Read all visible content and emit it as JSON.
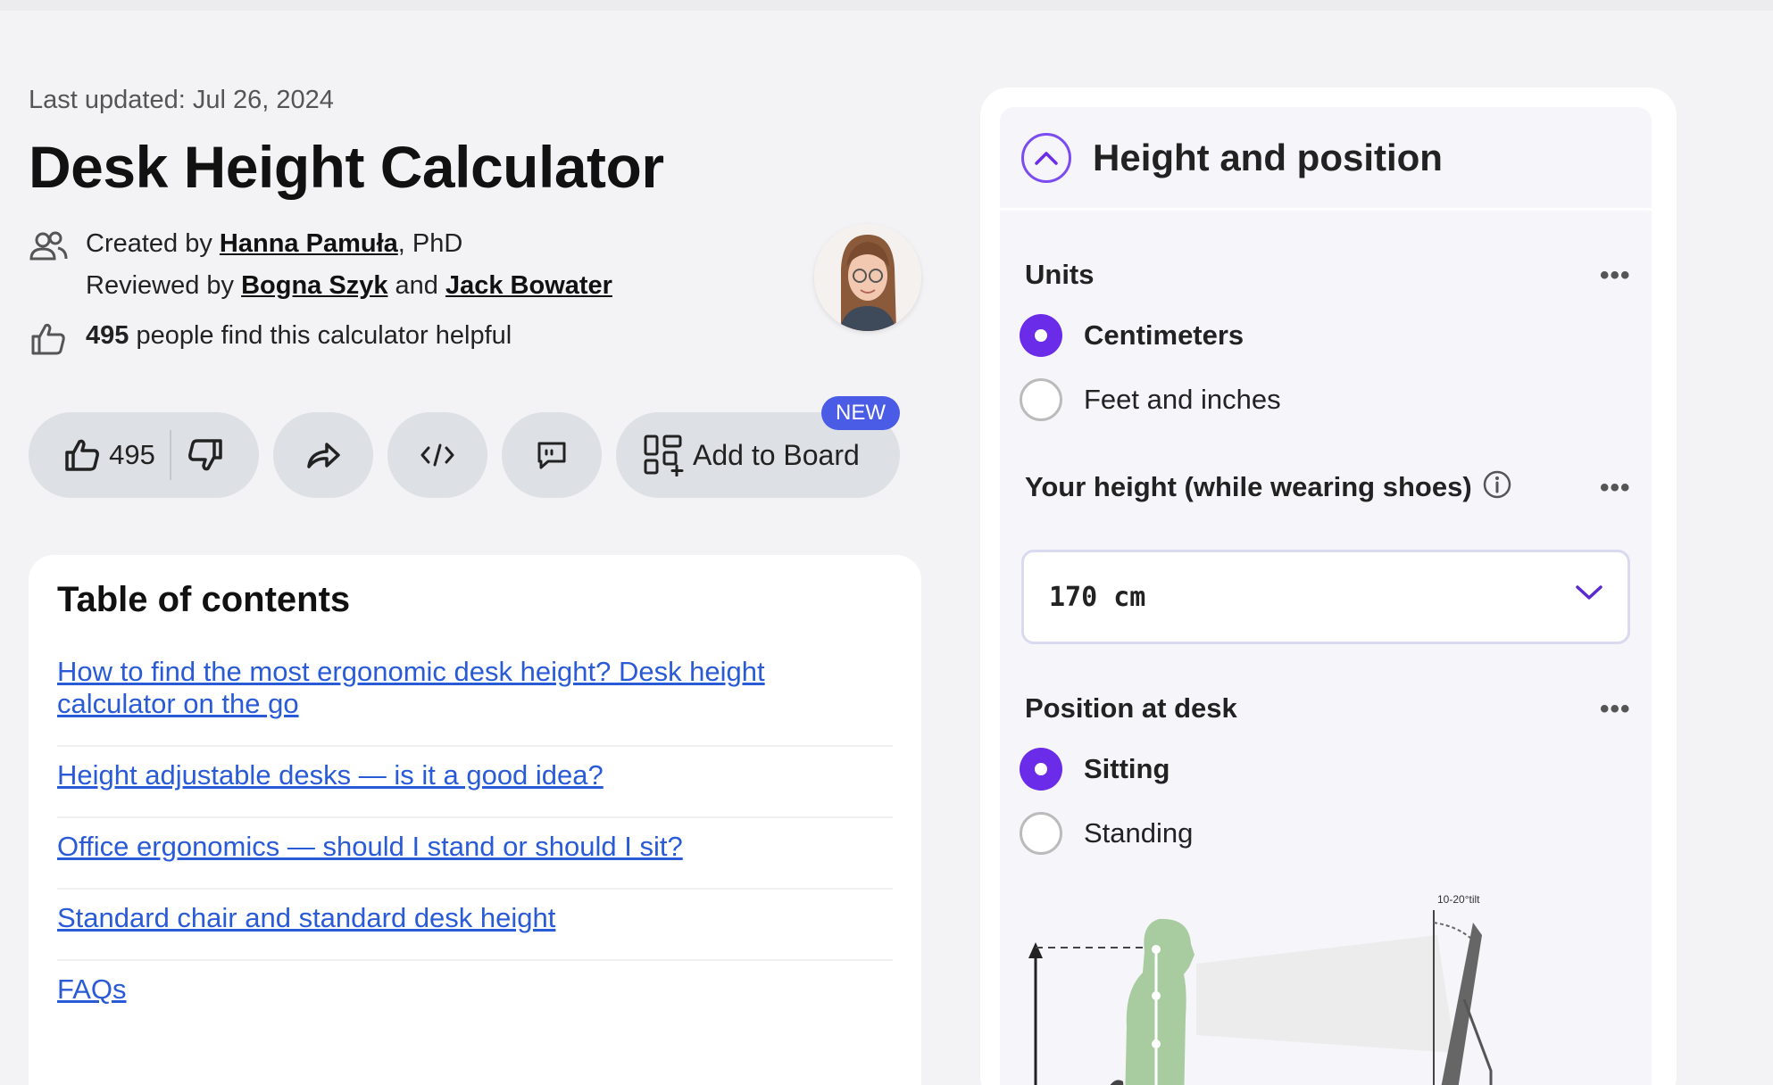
{
  "page": {
    "last_updated": "Last updated: Jul 26, 2024",
    "title": "Desk Height Calculator"
  },
  "byline": {
    "created_prefix": "Created by ",
    "author": "Hanna Pamuła",
    "author_suffix": ", PhD",
    "reviewed_prefix": "Reviewed by ",
    "reviewer1": "Bogna Szyk",
    "and": " and ",
    "reviewer2": "Jack Bowater",
    "helpful_count": "495",
    "helpful_text": " people find this calculator helpful"
  },
  "actions": {
    "like_count": "495",
    "add_to_board": "Add to Board",
    "new_badge": "NEW"
  },
  "toc": {
    "heading": "Table of contents",
    "items": [
      "How to find the most ergonomic desk height? Desk height calculator on the go",
      "Height adjustable desks — is it a good idea?",
      "Office ergonomics — should I stand or should I sit?",
      "Standard chair and standard desk height",
      "FAQs"
    ]
  },
  "panel": {
    "section_title": "Height and position",
    "units_label": "Units",
    "units_options": [
      "Centimeters",
      "Feet and inches"
    ],
    "units_selected": "Centimeters",
    "height_label": "Your height (while wearing shoes)",
    "height_value": "170 cm",
    "position_label": "Position at desk",
    "position_options": [
      "Sitting",
      "Standing"
    ],
    "position_selected": "Sitting",
    "more": "•••",
    "tilt_label": "10-20°tilt"
  },
  "colors": {
    "accent": "#6a2ce8",
    "link": "#2a5bd7",
    "badge": "#4a5be6"
  }
}
